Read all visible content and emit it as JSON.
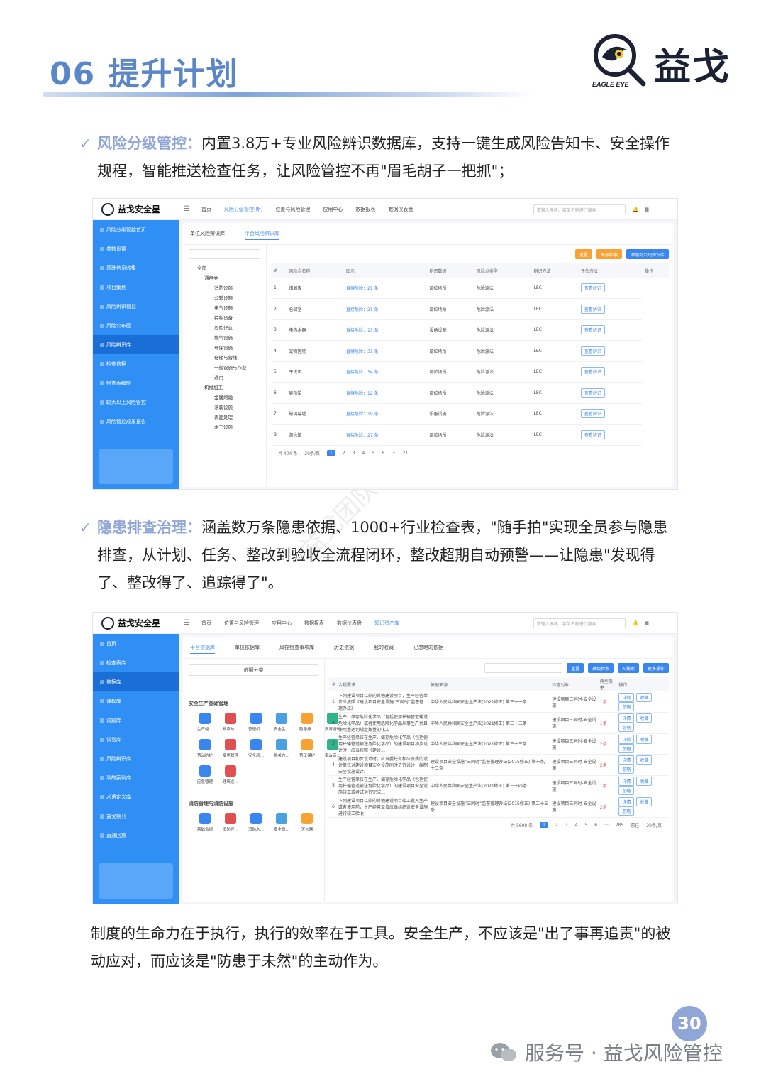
{
  "header": {
    "title": "06 提升计划",
    "brand": "益戈",
    "brand_en": "EAGLE EYE"
  },
  "section1": {
    "heading": "风险分级管控：",
    "body": "内置3.8万+专业风险辨识数据库，支持一键生成风险告知卡、安全操作规程，智能推送检查任务，让风险管控不再\"眉毛胡子一把抓\"；"
  },
  "section2": {
    "heading": "隐患排查治理：",
    "body": "涵盖数万条隐患依据、1000+行业检查表，\"随手拍\"实现全员参与隐患排查，从计划、任务、整改到验收全流程闭环，整改超期自动预警——让隐患\"发现得了、整改得了、追踪得了\"。"
  },
  "closing": "制度的生命力在于执行，执行的效率在于工具。安全生产，不应该是\"出了事再追责\"的被动应对，而应该是\"防患于未然\"的主动作为。",
  "page_number": "30",
  "footer": "服务号 · 益戈风险管控",
  "watermark": "益戈团队@版权所有",
  "shot1": {
    "app": "益戈安全星",
    "nav": [
      "首页",
      "风险分级管控(新)",
      "位置与风险管理",
      "应用中心",
      "数据报表",
      "数据仪表盘",
      "···"
    ],
    "search_placeholder": "请输入模块、菜单名称进行搜索",
    "sidebar": [
      "风险分级管控首页",
      "参数设置",
      "基础信息收集",
      "项目策划",
      "风险辨识管控",
      "风险公布图",
      "风险辨识库",
      "检查依据",
      "检查表编制",
      "较大以上风险管控",
      "风险管控成果报告"
    ],
    "tabs": [
      "单位风险辨识库",
      "平台风险辨识库"
    ],
    "buttons": [
      "重置",
      "高级检索",
      "添加到公司辨识库"
    ],
    "tree": [
      "全部",
      "通用类",
      "消防设施",
      "公辅设施",
      "电气设施",
      "特种设备",
      "危险作业",
      "燃气设施",
      "环保设施",
      "仓储与营线",
      "一般设施与作业",
      "通用",
      "机械加工",
      "金属熔融",
      "涂装设施",
      "表面处理",
      "木工设施"
    ],
    "columns": [
      "#",
      "风险点名称",
      "图示",
      "辨识数据",
      "风险点类型",
      "辨识方法",
      "评估方法",
      "操作"
    ],
    "rows": [
      [
        "1",
        "钢屑库",
        "直接危险：21 条",
        "部位场所",
        "危险源法",
        "LEC",
        "查看辨识"
      ],
      [
        "2",
        "仓储室",
        "直接危险：21 条",
        "部位场所",
        "危险源法",
        "LEC",
        "查看辨识"
      ],
      [
        "3",
        "电热水器",
        "直接危险：13 条",
        "设备设施",
        "危险源法",
        "LEC",
        "查看辨识"
      ],
      [
        "4",
        "宠物医院",
        "直接危险：31 条",
        "部位场所",
        "危险源法",
        "LEC",
        "查看辨识"
      ],
      [
        "5",
        "干洗店",
        "直接危险：34 条",
        "部位场所",
        "危险源法",
        "LEC",
        "查看辨识"
      ],
      [
        "6",
        "展示馆",
        "直接危险：12 条",
        "部位场所",
        "危险源法",
        "LEC",
        "查看辨识"
      ],
      [
        "7",
        "玻璃幕墙",
        "直接危险：19 条",
        "设备设施",
        "危险源法",
        "LEC",
        "查看辨识"
      ],
      [
        "8",
        "游泳馆",
        "直接危险：27 条",
        "部位场所",
        "危险源法",
        "LEC",
        "查看辨识"
      ]
    ],
    "total": "共 404 条",
    "per_page": "20条/页",
    "pages": [
      "1",
      "2",
      "3",
      "4",
      "5",
      "6",
      "···",
      "21"
    ]
  },
  "shot2": {
    "app": "益戈安全星",
    "nav": [
      "首页",
      "位置与风险管理",
      "应用中心",
      "数据报表",
      "数据仪表盘",
      "知识资产库",
      "···"
    ],
    "sidebar": [
      "首页",
      "检查表库",
      "依据库",
      "课程库",
      "试题库",
      "试卷库",
      "风险辨识库",
      "事故案例库",
      "术语定义库",
      "益戈期刊",
      "直通回放"
    ],
    "tabs": [
      "平台依据库",
      "单位依据库",
      "风控检查事项库",
      "历史依据",
      "我的收藏",
      "已忽略的依据"
    ],
    "category_select": "依据分类",
    "groups": [
      "安全生产基础管理",
      "消防管理与消防设施"
    ],
    "icons1": [
      "生产经…",
      "规章与…",
      "管理机…",
      "安全生…",
      "隐患排…",
      "教育培训",
      "劳动防护",
      "变更管理",
      "安全风…",
      "相关方…",
      "劳工保护",
      "事故报…",
      "应急管理",
      "建筑运…"
    ],
    "icons2": [
      "基础合规",
      "消防控…",
      "消防水…",
      "安全疏…",
      "灭火器"
    ],
    "buttons": [
      "重置",
      "高级检索",
      "AI搜索",
      "更多操作"
    ],
    "columns": [
      "#",
      "合规要求",
      "依据来源",
      "检查对象",
      "典型隐患",
      "操作"
    ],
    "rows": [
      [
        "1",
        "下列建设项目以外的其他建设项目，生产经营单位应按照《建设项目安全设施“三同时”监督管理办法》",
        "中华人民共和国安全生产法(2021修正) 第三十一条",
        "建设项目三同时-安全设施",
        "1条"
      ],
      [
        "2",
        "生产、储存危险化学品（包括使用长输管道输送危险化学品）或者使用危险化学品从事生产并且使用量达到规定数量的化工",
        "中华人民共和国安全生产法(2021修正) 第三十二条",
        "建设项目三同时-安全设施",
        "1条"
      ],
      [
        "3",
        "生产经营单位在生产、储存危险化学品（包括使用长输管道输送危险化学品）的建设项目初步设计时，应当按照《建设…",
        "中华人民共和国安全生产法(2021修正) 第三十三条",
        "建设项目三同时-安全设施",
        "2条"
      ],
      [
        "4",
        "建设项目初步设计时，应当委托有相应资质的设计单位对建设项目安全设施同时进行设计，编制安全设施设计。",
        "建设项目安全设施“三同时”监督管理办法(2015修正) 第十条/十二条",
        "建设项目三同时-安全设施",
        "2条"
      ],
      [
        "5",
        "生产经营单位在生产、储存危险化学品（包括使用长输管道输送危险化学品）的建设项目安全设施竣工或者试运行完成…",
        "中华人民共和国安全生产法(2021修正) 第三十四条",
        "建设项目三同时-安全设施",
        "1条"
      ],
      [
        "6",
        "下列建设项目以外的其他建设项目竣工投入生产或者使用前，生产经营单位应当组织对安全设施进行竣工验收",
        "建设项目安全设施“三同时”监督管理办法(2015修正) 第二十三条",
        "建设项目三同时-安全设施",
        "2条"
      ]
    ],
    "row_actions": [
      "详情",
      "收藏",
      "忽略"
    ],
    "total": "共 5698 条",
    "pages": [
      "1",
      "2",
      "3",
      "4",
      "5",
      "6",
      "···",
      "285"
    ],
    "goto": "前往",
    "per_page": "20条/页"
  },
  "colors": {
    "accent": "#8fa6d6",
    "sidebar": "#2f8ff5",
    "primary": "#3a86f0",
    "orange": "#f7a232"
  }
}
